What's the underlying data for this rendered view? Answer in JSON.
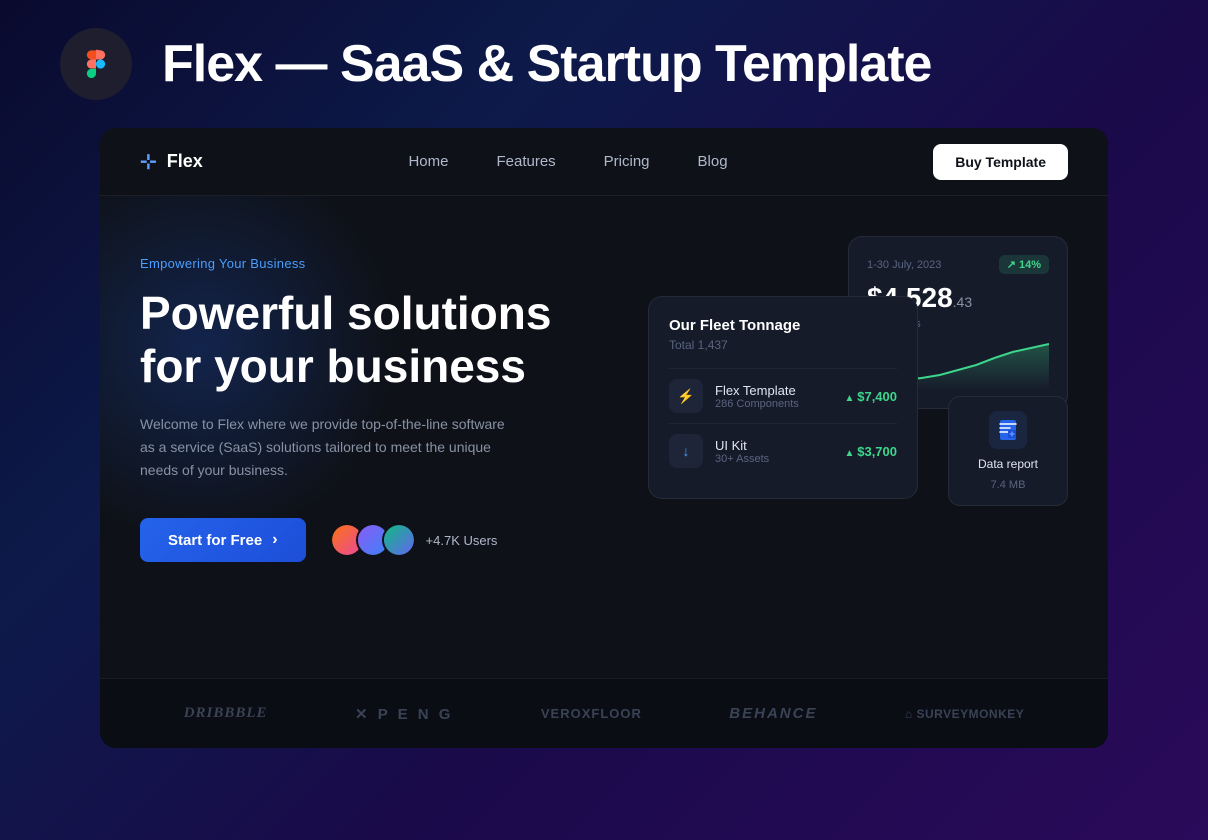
{
  "header": {
    "title": "Flex — SaaS & Startup Template"
  },
  "navbar": {
    "logo_text": "Flex",
    "links": [
      {
        "label": "Home",
        "id": "home"
      },
      {
        "label": "Features",
        "id": "features"
      },
      {
        "label": "Pricing",
        "id": "pricing"
      },
      {
        "label": "Blog",
        "id": "blog"
      }
    ],
    "buy_button": "Buy Template"
  },
  "hero": {
    "tagline": "Empowering Your Business",
    "title_line1": "Powerful solutions",
    "title_line2": "for your business",
    "description": "Welcome to Flex where we provide top-of-the-line software as a service (SaaS) solutions tailored to meet the unique needs of your business.",
    "cta_button": "Start for Free",
    "user_count": "+4.7K Users"
  },
  "fleet_card": {
    "title": "Our Fleet Tonnage",
    "subtitle": "Total 1,437",
    "items": [
      {
        "name": "Flex Template",
        "detail": "286 Components",
        "value": "$7,400",
        "icon": "⚡"
      },
      {
        "name": "UI Kit",
        "detail": "30+ Assets",
        "value": "$3,700",
        "icon": "⬇"
      }
    ]
  },
  "revenue_card": {
    "date": "1-30 July, 2023",
    "badge": "14%",
    "amount_main": "$4,528",
    "amount_cents": ".43",
    "label": "Total Sales"
  },
  "report_card": {
    "title": "Data report",
    "size": "7.4 MB"
  },
  "logos": [
    {
      "name": "Dribbble",
      "style": "dribbble"
    },
    {
      "name": "✕ PENG",
      "style": "peng"
    },
    {
      "name": "veroxfloor",
      "style": "verox"
    },
    {
      "name": "Behance",
      "style": "behance"
    },
    {
      "name": "SurveyMonkey",
      "style": "survey"
    }
  ],
  "colors": {
    "accent_blue": "#2563eb",
    "accent_green": "#3dd68c",
    "accent_light_blue": "#4a9eff",
    "bg_dark": "#0e1117",
    "card_bg": "#161b2a"
  }
}
